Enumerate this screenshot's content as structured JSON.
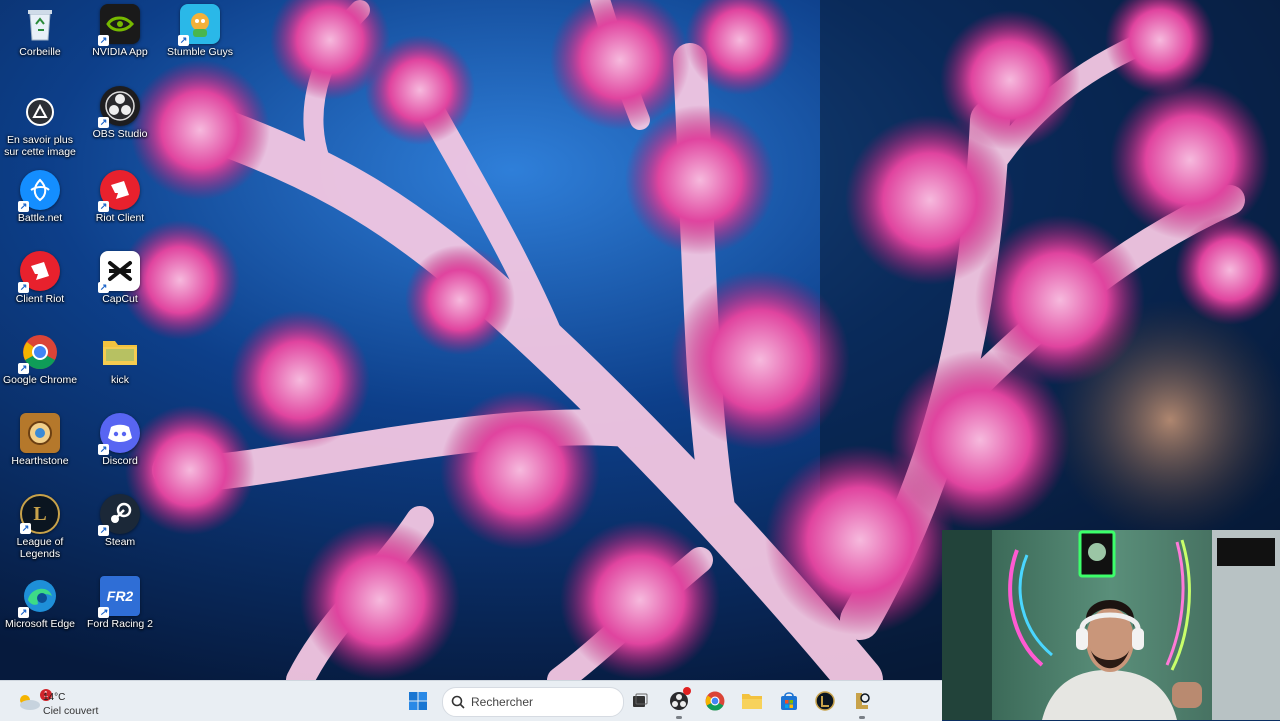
{
  "desktop": {
    "icons": [
      {
        "label": "Corbeille",
        "icon": "recycle-bin-icon"
      },
      {
        "label": "NVIDIA App",
        "icon": "nvidia-icon"
      },
      {
        "label": "Stumble Guys",
        "icon": "stumble-guys-icon"
      },
      {
        "label": "En savoir plus sur cette image",
        "icon": "learn-about-image-icon"
      },
      {
        "label": "OBS Studio",
        "icon": "obs-studio-icon"
      },
      {
        "label": "Battle.net",
        "icon": "battlenet-icon"
      },
      {
        "label": "Riot Client",
        "icon": "riot-client-icon"
      },
      {
        "label": "Client Riot",
        "icon": "client-riot-icon"
      },
      {
        "label": "CapCut",
        "icon": "capcut-icon"
      },
      {
        "label": "Google Chrome",
        "icon": "google-chrome-icon"
      },
      {
        "label": "kick",
        "icon": "folder-icon"
      },
      {
        "label": "Hearthstone",
        "icon": "hearthstone-icon"
      },
      {
        "label": "Discord",
        "icon": "discord-icon"
      },
      {
        "label": "League of Legends",
        "icon": "league-of-legends-icon"
      },
      {
        "label": "Steam",
        "icon": "steam-icon"
      },
      {
        "label": "Microsoft Edge",
        "icon": "microsoft-edge-icon"
      },
      {
        "label": "Ford Racing 2",
        "icon": "ford-racing-2-icon"
      }
    ]
  },
  "taskbar": {
    "weather": {
      "temperature": "14°C",
      "condition": "Ciel couvert",
      "badge": "1",
      "icon": "cloud-sun-icon"
    },
    "search_placeholder": "Rechercher",
    "apps": [
      "start-icon",
      "search-icon",
      "task-view-icon",
      "obs-studio-icon",
      "google-chrome-icon",
      "file-explorer-icon",
      "microsoft-store-icon",
      "league-of-legends-icon",
      "league-client-icon"
    ]
  },
  "colors": {
    "taskbar_bg": "#e9eef3",
    "coral_pink": "#e0308f",
    "water_blue": "#0c3e86"
  }
}
